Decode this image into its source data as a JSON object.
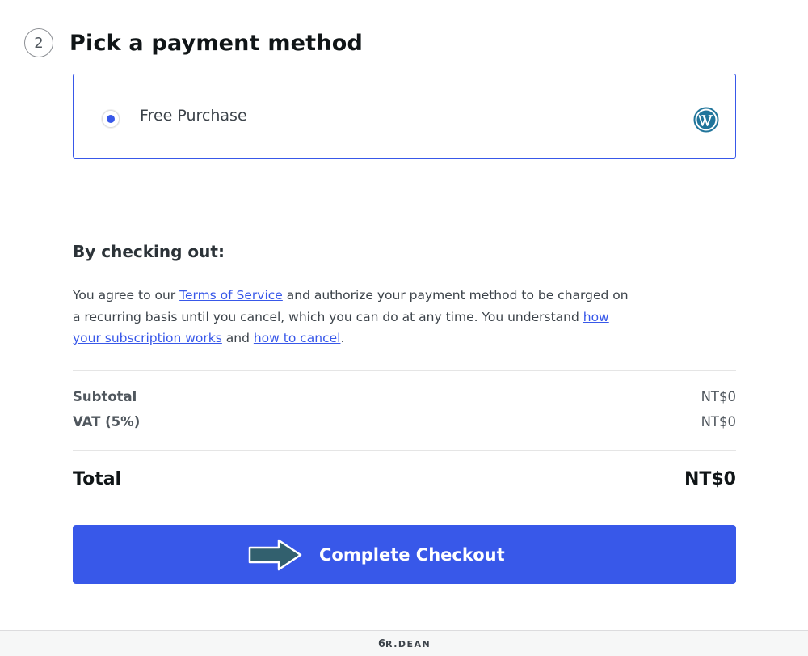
{
  "step": {
    "number": "2",
    "title": "Pick a payment method"
  },
  "payment_option": {
    "label": "Free Purchase",
    "selected": true,
    "icon": "wordpress-logo-icon",
    "accent_color": "#3858e9"
  },
  "terms": {
    "heading": "By checking out:",
    "text_1": "You agree to our ",
    "link_tos": "Terms of Service",
    "text_2": " and authorize your payment method to be charged on a recurring basis until you cancel, which you can do at any time. You understand ",
    "link_subscription": "how your subscription works",
    "text_3": " and ",
    "link_cancel": "how to cancel",
    "text_4": "."
  },
  "summary": {
    "subtotal_label": "Subtotal",
    "subtotal_value": "NT$0",
    "vat_label": "VAT (5%)",
    "vat_value": "NT$0",
    "total_label": "Total",
    "total_value": "NT$0"
  },
  "checkout_button": {
    "label": "Complete Checkout",
    "color": "#3858e9",
    "pointer_icon": "arrow-right-icon"
  },
  "footer": {
    "brand": "R.DEAN",
    "brand_mark": "6"
  }
}
